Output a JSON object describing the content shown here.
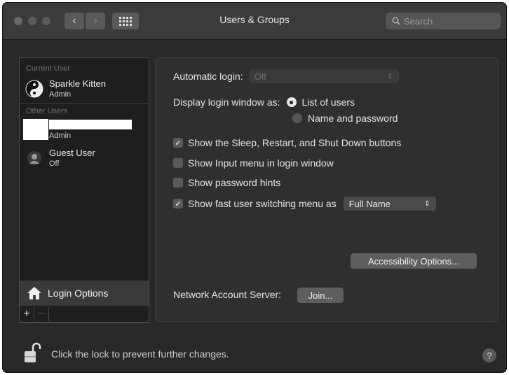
{
  "window": {
    "title": "Users & Groups",
    "search_placeholder": "Search"
  },
  "sidebar": {
    "current_user_label": "Current User",
    "current_user": {
      "name": "Sparkle Kitten",
      "role": "Admin"
    },
    "other_users_label": "Other Users",
    "other_users": [
      {
        "name": "",
        "role": "Admin"
      },
      {
        "name": "Guest User",
        "role": "Off"
      }
    ],
    "login_options_label": "Login Options",
    "add_label": "+",
    "remove_label": "−"
  },
  "panel": {
    "automatic_login_label": "Automatic login:",
    "automatic_login_value": "Off",
    "display_login_label": "Display login window as:",
    "radio_list_of_users": "List of users",
    "radio_name_password": "Name and password",
    "cb_sleep_restart": "Show the Sleep, Restart, and Shut Down buttons",
    "cb_input_menu": "Show Input menu in login window",
    "cb_password_hints": "Show password hints",
    "cb_fast_switching": "Show fast user switching menu as",
    "fast_switching_value": "Full Name",
    "accessibility_button": "Accessibility Options...",
    "network_server_label": "Network Account Server:",
    "join_button": "Join..."
  },
  "footer": {
    "lock_text": "Click the lock to prevent further changes.",
    "help_label": "?"
  },
  "state": {
    "selected_radio": "list_of_users",
    "cb_sleep_restart": true,
    "cb_input_menu": false,
    "cb_password_hints": false,
    "cb_fast_switching": true
  },
  "colors": {
    "window_bg": "#282828",
    "titlebar_bg": "#3b3b3b",
    "sidebar_bg": "#1e1e1e",
    "selected_row_bg": "#3a3a3a"
  }
}
